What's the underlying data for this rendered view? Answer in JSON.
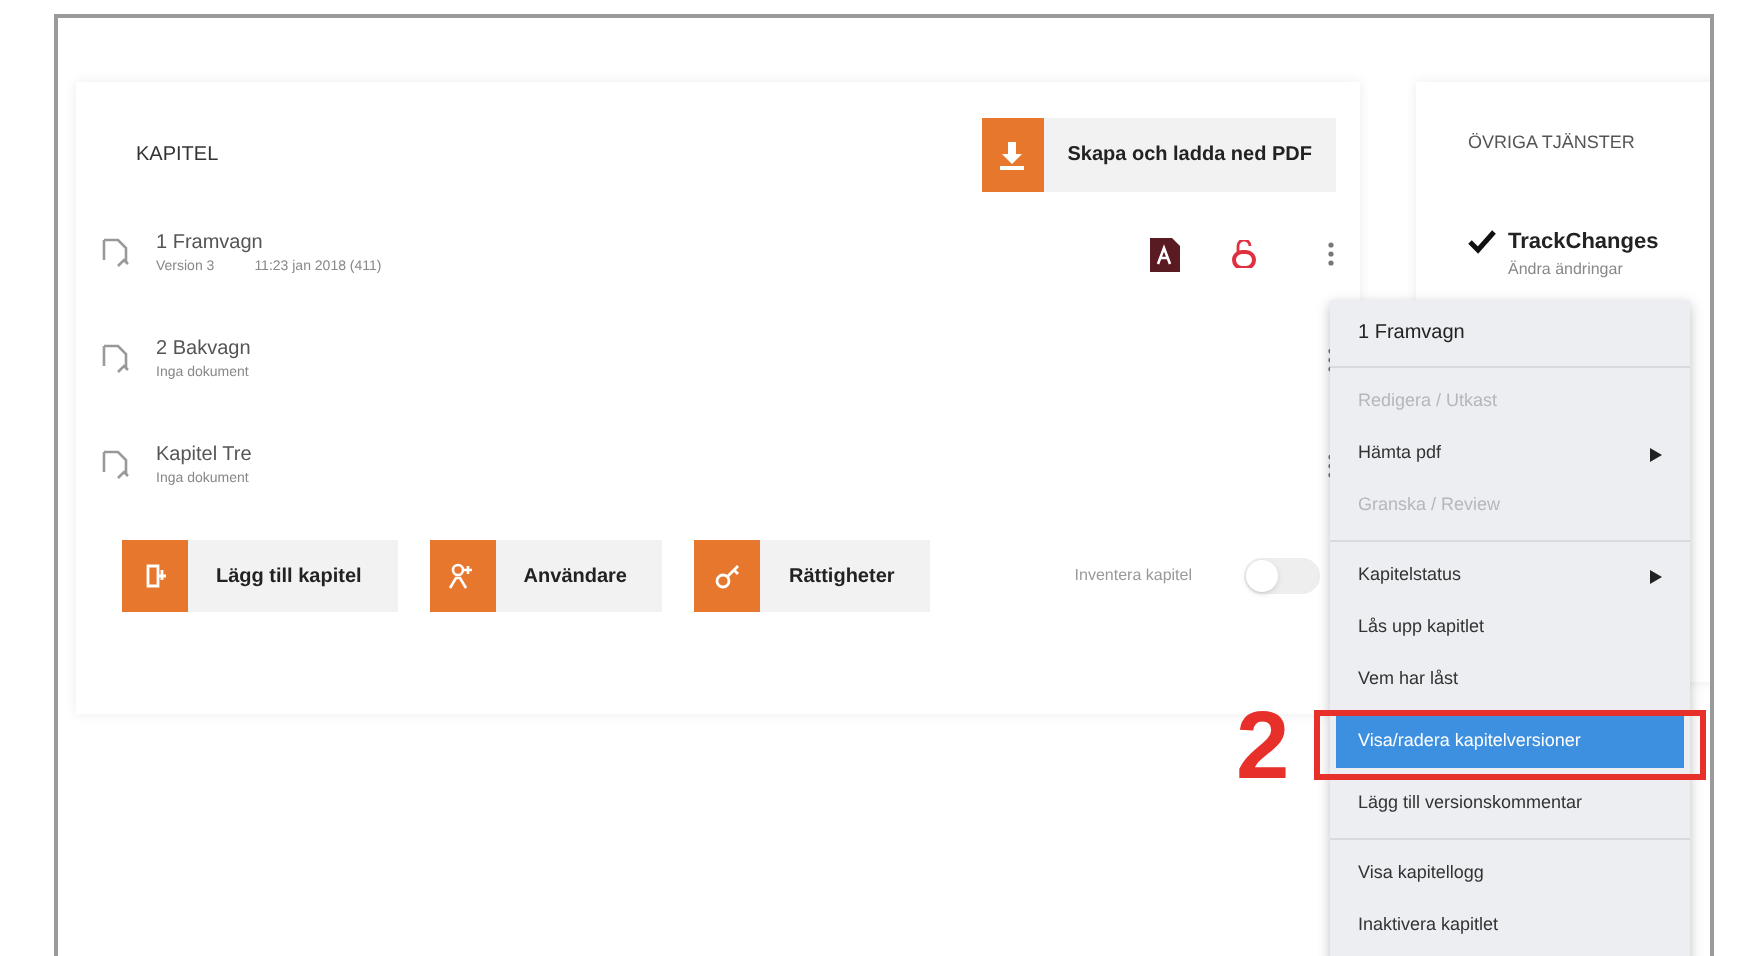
{
  "chapters_panel": {
    "title": "KAPITEL",
    "pdf_button": "Skapa och ladda ned PDF",
    "chapters": [
      {
        "name": "1 Framvagn",
        "status": "Version 3",
        "date": "11:23 jan 2018 (411)",
        "has_pdf": true
      },
      {
        "name": "2 Bakvagn",
        "status": "Inga dokument",
        "has_pdf": false
      },
      {
        "name": "Kapitel Tre",
        "status": "Inga dokument",
        "has_pdf": false
      }
    ],
    "actions": [
      {
        "label": "Lägg till kapitel",
        "kind": "add"
      },
      {
        "label": "Användare",
        "kind": "users"
      },
      {
        "label": "Rättigheter",
        "kind": "key"
      }
    ],
    "toggle": {
      "label": "Inventera kapitel",
      "on": false
    }
  },
  "services_panel": {
    "title": "ÖVRIGA TJÄNSTER",
    "service": "TrackChanges",
    "service_sub": "Ändra ändringar"
  },
  "context_menu": {
    "title": "1 Framvagn",
    "groups": [
      [
        {
          "label": "Redigera / Utkast",
          "disabled": true,
          "submenu": false,
          "selected": false
        },
        {
          "label": "Hämta pdf",
          "disabled": false,
          "submenu": true,
          "selected": false
        },
        {
          "label": "Granska / Review",
          "disabled": true,
          "submenu": false,
          "selected": false
        }
      ],
      [
        {
          "label": "Kapitelstatus",
          "disabled": false,
          "submenu": true,
          "selected": false
        },
        {
          "label": "Lås upp kapitlet",
          "disabled": false,
          "submenu": false,
          "selected": false
        },
        {
          "label": "Vem har låst",
          "disabled": false,
          "submenu": false,
          "selected": false
        },
        {
          "label": "Visa/radera kapitelversioner",
          "disabled": false,
          "submenu": false,
          "selected": true
        },
        {
          "label": "Lägg till versionskommentar",
          "disabled": false,
          "submenu": false,
          "selected": false
        }
      ],
      [
        {
          "label": "Visa kapitellogg",
          "disabled": false,
          "submenu": false,
          "selected": false
        },
        {
          "label": "Inaktivera kapitlet",
          "disabled": false,
          "submenu": false,
          "selected": false
        }
      ]
    ]
  },
  "annotation": {
    "label": "2"
  }
}
